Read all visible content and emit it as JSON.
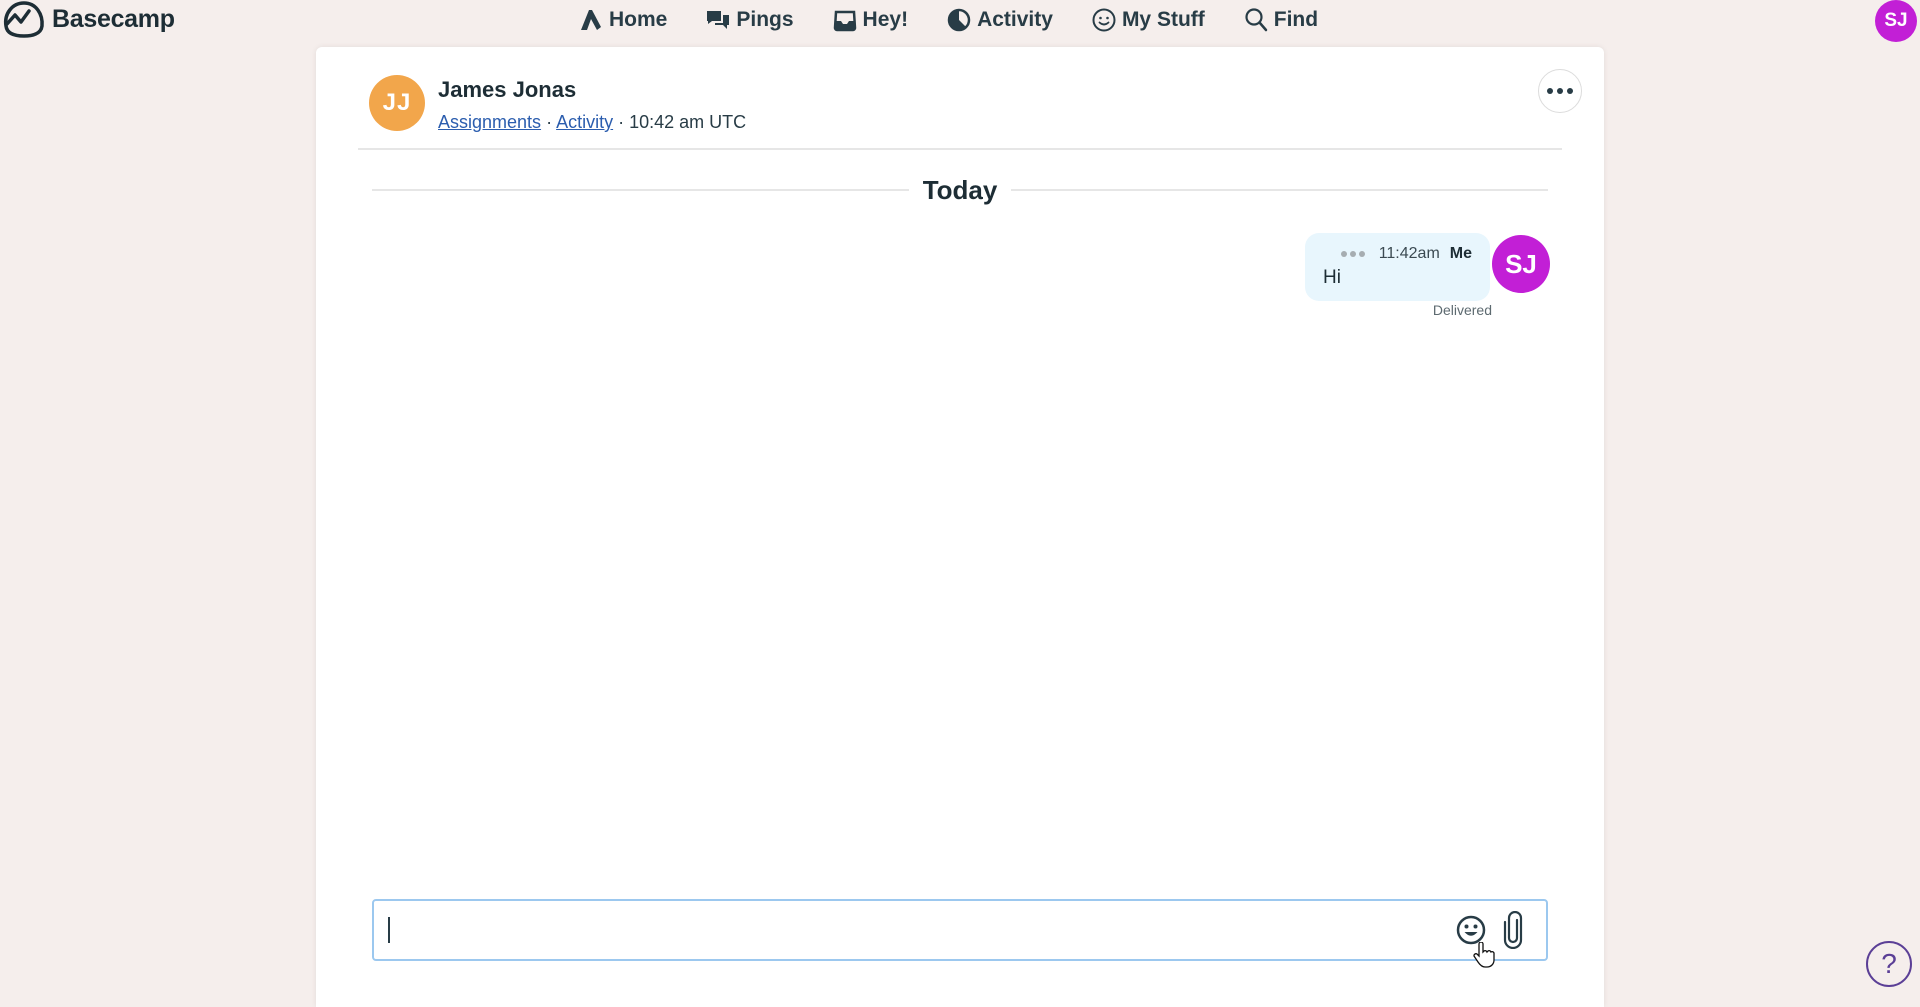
{
  "app": {
    "name": "Basecamp"
  },
  "nav": {
    "items": [
      {
        "label": "Home",
        "icon": "home-tent-icon"
      },
      {
        "label": "Pings",
        "icon": "chat-bubbles-icon"
      },
      {
        "label": "Hey!",
        "icon": "inbox-tray-icon"
      },
      {
        "label": "Activity",
        "icon": "half-moon-icon"
      },
      {
        "label": "My Stuff",
        "icon": "smiley-face-icon"
      },
      {
        "label": "Find",
        "icon": "magnifier-icon"
      }
    ]
  },
  "current_user": {
    "initials": "SJ",
    "color": "#c21fd6"
  },
  "conversation": {
    "person": {
      "name": "James Jonas",
      "initials": "JJ",
      "color": "#f2a64b"
    },
    "links": {
      "assignments": "Assignments",
      "activity": "Activity"
    },
    "separator": "·",
    "local_time": "10:42 am UTC",
    "more_button_icon": "ellipsis-icon"
  },
  "day_divider": "Today",
  "messages": [
    {
      "time": "11:42am",
      "author": "Me",
      "text": "Hi",
      "avatar_initials": "SJ",
      "status": "Delivered"
    }
  ],
  "composer": {
    "value": "",
    "placeholder": "",
    "emoji_icon": "emoji-icon",
    "attach_icon": "paperclip-icon"
  },
  "help": {
    "label": "?"
  },
  "colors": {
    "background": "#f5eeec",
    "link": "#2b5dae",
    "bubble": "#e8f6fd",
    "composer_border": "#9cc8ef",
    "help": "#5b3f96"
  }
}
